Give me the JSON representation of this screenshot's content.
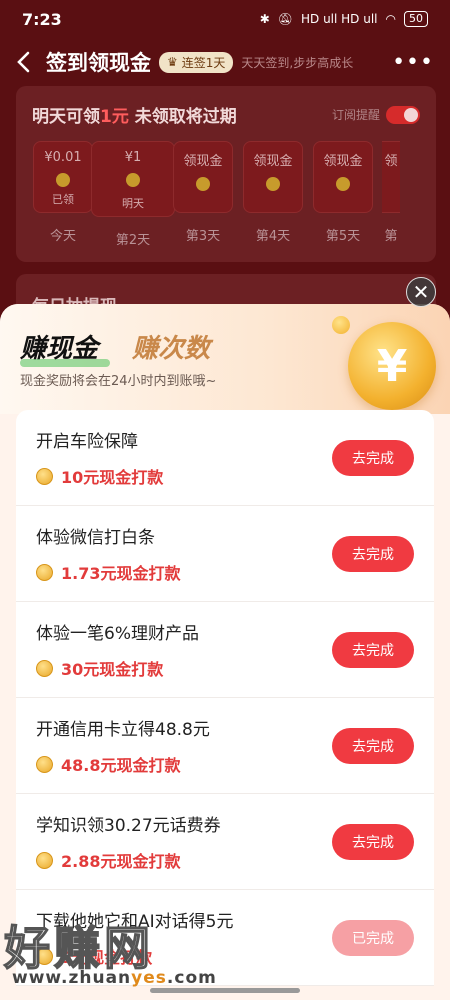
{
  "status_bar": {
    "time": "7:23",
    "battery": "50",
    "signal_text": "HD ull HD ull"
  },
  "header": {
    "title": "签到领现金",
    "streak_badge": "连签1天",
    "slogan": "天天签到,步步高成长"
  },
  "checkin": {
    "headline_prefix": "明天可领",
    "headline_amount": "1元",
    "headline_suffix": " 未领取将过期",
    "remind_label": "订阅提醒",
    "days": [
      {
        "top": "¥0.01",
        "sub": "已领",
        "label": "今天"
      },
      {
        "top": "¥1",
        "sub": "明天",
        "label": "第2天"
      },
      {
        "top": "领现金",
        "sub": "",
        "label": "第3天"
      },
      {
        "top": "领现金",
        "sub": "",
        "label": "第4天"
      },
      {
        "top": "领现金",
        "sub": "",
        "label": "第5天"
      },
      {
        "top": "领",
        "sub": "",
        "label": "第"
      }
    ],
    "section2_title": "每日抽提现"
  },
  "sheet": {
    "tab_active": "赚现金",
    "tab_inactive": "赚次数",
    "subtitle": "现金奖励将会在24小时内到账哦~",
    "coin_symbol": "¥",
    "tasks": [
      {
        "name": "开启车险保障",
        "reward": "10元现金打款",
        "button": "去完成"
      },
      {
        "name": "体验微信打白条",
        "reward": "1.73元现金打款",
        "button": "去完成"
      },
      {
        "name": "体验一笔6%理财产品",
        "reward": "30元现金打款",
        "button": "去完成"
      },
      {
        "name": "开通信用卡立得48.8元",
        "reward": "48.8元现金打款",
        "button": "去完成"
      },
      {
        "name": "学知识领30.27元话费券",
        "reward": "2.88元现金打款",
        "button": "去完成"
      },
      {
        "name": "下载他她它和AI对话得5元",
        "reward": "5元现金打款",
        "button": "已完成"
      }
    ]
  },
  "watermark": {
    "brand": "好赚网",
    "url_pre": "www.zhuan",
    "url_highlight": "yes",
    "url_post": ".com"
  }
}
